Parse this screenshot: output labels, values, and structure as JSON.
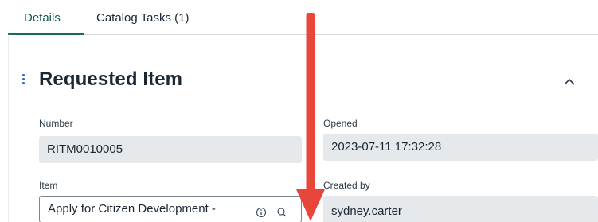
{
  "tabs": [
    {
      "label": "Details",
      "active": true
    },
    {
      "label": "Catalog Tasks (1)",
      "active": false
    }
  ],
  "section": {
    "title": "Requested Item"
  },
  "fields": {
    "number": {
      "label": "Number",
      "value": "RITM0010005"
    },
    "opened": {
      "label": "Opened",
      "value": "2023-07-11 17:32:28"
    },
    "item": {
      "label": "Item",
      "value": "Apply for Citizen Development -"
    },
    "created_by": {
      "label": "Created by",
      "value": "sydney.carter"
    }
  },
  "icons": {
    "drag": "drag-handle-icon",
    "collapse": "chevron-up-icon",
    "info": "info-icon",
    "search": "search-icon",
    "annotation": "red-down-arrow"
  },
  "colors": {
    "accent": "#1a6a5f",
    "arrow": "#e8463a",
    "field_bg": "#e6e9ec"
  }
}
